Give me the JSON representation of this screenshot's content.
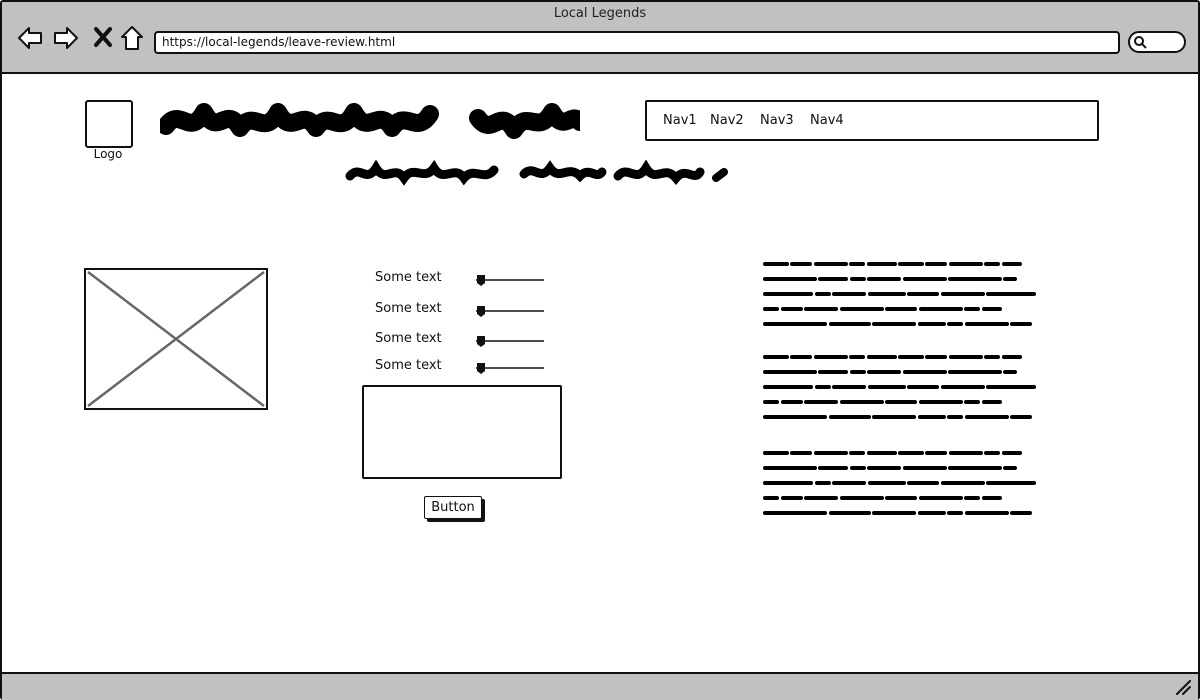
{
  "window": {
    "title": "Local Legends"
  },
  "browser": {
    "url": "https://local-legends/leave-review.html",
    "buttons": [
      "back-icon",
      "forward-icon",
      "close-icon",
      "home-icon"
    ],
    "search_icon": "search-icon"
  },
  "header": {
    "logo_label": "Logo",
    "nav": [
      "Nav1",
      "Nav2",
      "Nav3",
      "Nav4"
    ]
  },
  "form": {
    "sliders": [
      {
        "label": "Some text",
        "value": 0.1
      },
      {
        "label": "Some text",
        "value": 0.1
      },
      {
        "label": "Some text",
        "value": 0.1
      },
      {
        "label": "Some text",
        "value": 0.1
      }
    ],
    "button_label": "Button"
  }
}
